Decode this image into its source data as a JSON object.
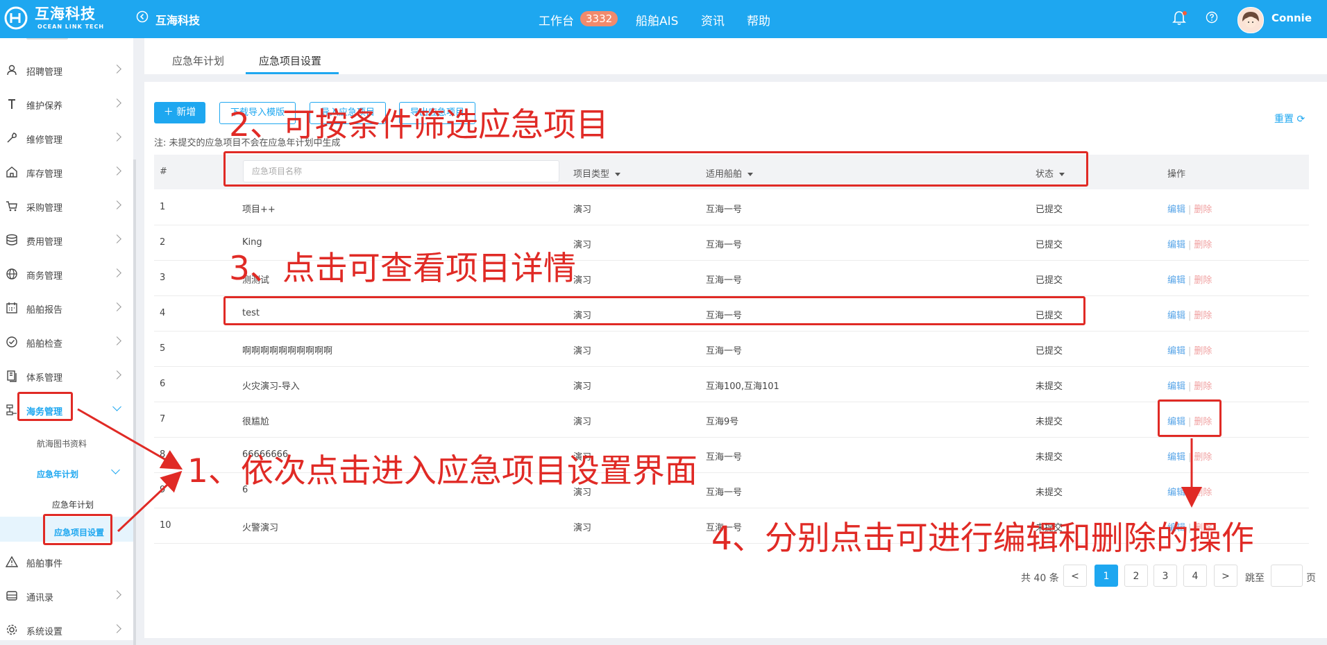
{
  "header": {
    "logo_name": "互海科技",
    "logo_sub": "OCEAN LINK TECH",
    "company": "互海科技",
    "nav": {
      "workbench": "工作台",
      "badge": "3332",
      "ais": "船舶AIS",
      "news": "资讯",
      "help": "帮助"
    },
    "username": "Connie"
  },
  "sidebar": {
    "items": [
      {
        "label": "招聘管理",
        "icon": "person-icon"
      },
      {
        "label": "维护保养",
        "icon": "wrench-icon"
      },
      {
        "label": "维修管理",
        "icon": "repair-icon"
      },
      {
        "label": "库存管理",
        "icon": "warehouse-icon"
      },
      {
        "label": "采购管理",
        "icon": "cart-icon"
      },
      {
        "label": "费用管理",
        "icon": "database-icon"
      },
      {
        "label": "商务管理",
        "icon": "globe-icon"
      },
      {
        "label": "船舶报告",
        "icon": "calendar-icon"
      },
      {
        "label": "船舶检查",
        "icon": "check-circle-icon"
      },
      {
        "label": "体系管理",
        "icon": "document-icon"
      },
      {
        "label": "海务管理",
        "icon": "org-icon"
      },
      {
        "label": "船舶事件",
        "icon": "warning-icon"
      },
      {
        "label": "通讯录",
        "icon": "contacts-icon"
      },
      {
        "label": "系统设置",
        "icon": "gear-icon"
      }
    ],
    "sub_library": "航海图书资料",
    "sub_plan": "应急年计划",
    "sub_plan_year": "应急年计划",
    "sub_project_settings": "应急项目设置"
  },
  "tabs": [
    "应急年计划",
    "应急项目设置"
  ],
  "toolbar": {
    "new_label": "新增",
    "download_template": "下载导入模版",
    "import_label": "导入应急项目",
    "export_label": "导出应急项目",
    "reset_label": "重置"
  },
  "note": "注: 未提交的应急项目不会在应急年计划中生成",
  "table": {
    "headers": {
      "index": "#",
      "name_placeholder": "应急项目名称",
      "type": "项目类型",
      "ship": "适用船舶",
      "status": "状态",
      "action": "操作"
    },
    "edit_label": "编辑",
    "delete_label": "删除",
    "rows": [
      {
        "index": "1",
        "name": "项目++",
        "type": "演习",
        "ship": "互海一号",
        "status": "已提交"
      },
      {
        "index": "2",
        "name": "King",
        "type": "演习",
        "ship": "互海一号",
        "status": "已提交"
      },
      {
        "index": "3",
        "name": "测测试",
        "type": "演习",
        "ship": "互海一号",
        "status": "已提交"
      },
      {
        "index": "4",
        "name": "test",
        "type": "演习",
        "ship": "互海一号",
        "status": "已提交"
      },
      {
        "index": "5",
        "name": "啊啊啊啊啊啊啊啊啊啊",
        "type": "演习",
        "ship": "互海一号",
        "status": "已提交"
      },
      {
        "index": "6",
        "name": "火灾演习-导入",
        "type": "演习",
        "ship": "互海100,互海101",
        "status": "未提交"
      },
      {
        "index": "7",
        "name": "很尴尬",
        "type": "演习",
        "ship": "互海9号",
        "status": "未提交"
      },
      {
        "index": "8",
        "name": "66666666",
        "type": "演习",
        "ship": "互海一号",
        "status": "未提交"
      },
      {
        "index": "9",
        "name": "6",
        "type": "演习",
        "ship": "互海一号",
        "status": "未提交"
      },
      {
        "index": "10",
        "name": "火警演习",
        "type": "演习",
        "ship": "互海一号",
        "status": "未提交"
      }
    ]
  },
  "pagination": {
    "total": "共 40 条",
    "prev": "<",
    "next": ">",
    "pages": [
      "1",
      "2",
      "3",
      "4"
    ],
    "jump": "跳至",
    "page_suffix": "页"
  },
  "annotations": {
    "step1": "1、依次点击进入应急项目设置界面",
    "step2": "2、可按条件筛选应急项目",
    "step3": "3、点击可查看项目详情",
    "step4": "4、分别点击可进行编辑和删除的操作"
  },
  "colors": {
    "brand": "#1ea7f0",
    "annotation": "#e02a25",
    "badge": "#f18a6c"
  }
}
